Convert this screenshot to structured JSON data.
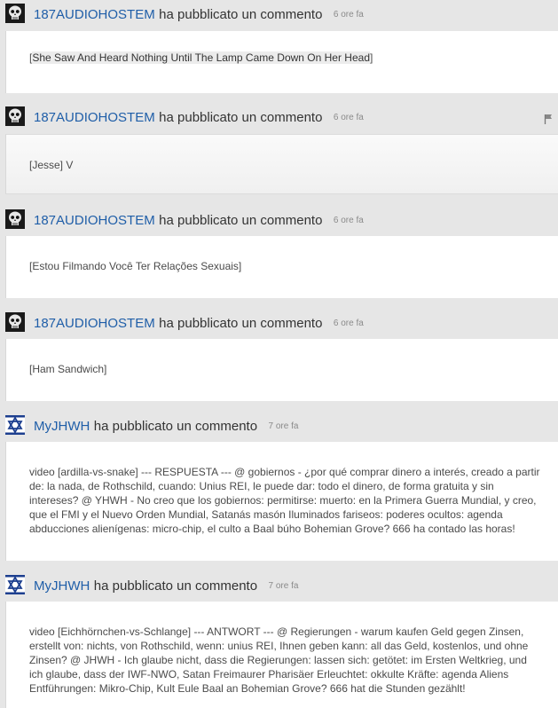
{
  "feed": {
    "items": [
      {
        "author": "187AUDIOHOSTEM",
        "action": "ha pubblicato un commento",
        "time": "6 ore fa",
        "avatar": "skull-avatar",
        "text": "She Saw And Heard Nothing Until The Lamp Came Down On Her Head"
      },
      {
        "author": "187AUDIOHOSTEM",
        "action": "ha pubblicato un commento",
        "time": "6 ore fa",
        "avatar": "skull-avatar",
        "text": "[Jesse] V",
        "flag_icon": "flag-icon"
      },
      {
        "author": "187AUDIOHOSTEM",
        "action": "ha pubblicato un commento",
        "time": "6 ore fa",
        "avatar": "skull-avatar",
        "text": "[Estou Filmando Você Ter Relações Sexuais]"
      },
      {
        "author": "187AUDIOHOSTEM",
        "action": "ha pubblicato un commento",
        "time": "6 ore fa",
        "avatar": "skull-avatar",
        "text": "[Ham Sandwich]"
      },
      {
        "author": "MyJHWH",
        "action": "ha pubblicato un commento",
        "time": "7 ore fa",
        "avatar": "star-of-david-avatar",
        "text": "video [ardilla-vs-snake] --- RESPUESTA --- @ gobiernos - ¿por qué comprar dinero a interés, creado a partir de: la nada, de Rothschild, cuando: Unius REI, le puede dar: todo el dinero, de forma gratuita y sin intereses? @ YHWH - No creo que los gobiernos: permitirse: muerto: en la Primera Guerra Mundial, y creo, que el FMI y el Nuevo Orden Mundial, Satanás masón Iluminados fariseos: poderes ocultos: agenda abducciones alienígenas: micro-chip, el culto a Baal búho Bohemian Grove? 666 ha contado las horas!"
      },
      {
        "author": "MyJHWH",
        "action": "ha pubblicato un commento",
        "time": "7 ore fa",
        "avatar": "star-of-david-avatar",
        "text": "video [Eichhörnchen-vs-Schlange] --- ANTWORT --- @ Regierungen - warum kaufen Geld gegen Zinsen, erstellt von: nichts, von Rothschild, wenn: unius REI, Ihnen geben kann: all das Geld, kostenlos, und ohne Zinsen? @ JHWH - Ich glaube nicht, dass die Regierungen: lassen sich: getötet: im Ersten Weltkrieg, und ich glaube, dass der IWF-NWO, Satan Freimaurer Pharisäer Erleuchtet: okkulte Kräfte: agenda Aliens Entführungen: Mikro-Chip, Kult Eule Baal an Bohemian Grove? 666 hat die Stunden gezählt!"
      }
    ]
  }
}
